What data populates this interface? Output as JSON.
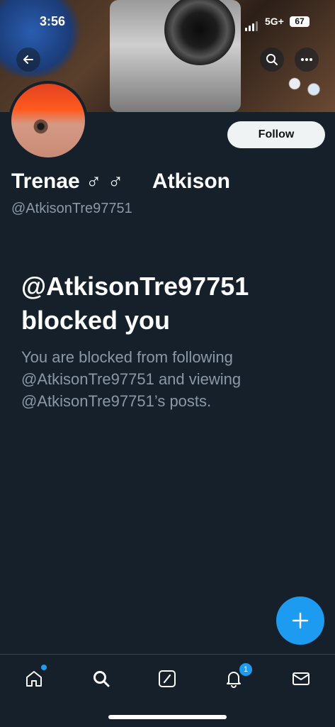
{
  "status_bar": {
    "time": "3:56",
    "network": "5G+",
    "battery": "67"
  },
  "header": {
    "back_icon": "arrow-left-icon",
    "search_icon": "search-icon",
    "more_icon": "more-horizontal-icon"
  },
  "profile": {
    "name": "Trenae ♂ ♂     Atkison",
    "handle": "@AtkisonTre97751",
    "follow_label": "Follow"
  },
  "blocked": {
    "title": "@AtkisonTre97751 blocked you",
    "message": "You are blocked from following @AtkisonTre97751 and viewing @AtkisonTre97751’s posts."
  },
  "fab": {
    "icon": "plus-icon"
  },
  "bottom_nav": {
    "items": [
      {
        "icon": "home-icon",
        "has_dot": true
      },
      {
        "icon": "search-icon"
      },
      {
        "icon": "grok-icon"
      },
      {
        "icon": "bell-icon",
        "badge": "1"
      },
      {
        "icon": "mail-icon"
      }
    ]
  },
  "colors": {
    "accent": "#1d9bf0",
    "background": "#15202b",
    "muted": "#8b98a5"
  }
}
